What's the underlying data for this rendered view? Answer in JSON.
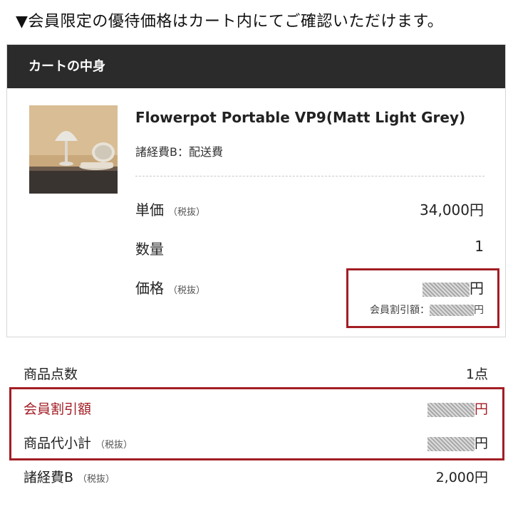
{
  "notice": "▼会員限定の優待価格はカート内にてご確認いただけます。",
  "cart": {
    "header": "カートの中身",
    "product": {
      "name": "Flowerpot Portable VP9(Matt Light Grey)",
      "sub": "諸経費B：配送費",
      "unit_price_label": "単価",
      "unit_price_tax": "（税抜）",
      "unit_price_value": "34,000円",
      "quantity_label": "数量",
      "quantity_value": "1",
      "price_label": "価格",
      "price_tax": "（税抜）",
      "price_suffix": "円",
      "member_discount_label": "会員割引額：",
      "member_discount_suffix": "円"
    }
  },
  "summary": {
    "item_count_label": "商品点数",
    "item_count_value": "1点",
    "member_discount_label": "会員割引額",
    "member_discount_suffix": "円",
    "subtotal_label": "商品代小計",
    "subtotal_tax": "（税抜）",
    "subtotal_suffix": "円",
    "expense_label": "諸経費B",
    "expense_tax": "（税抜）",
    "expense_value": "2,000円"
  },
  "colors": {
    "header_bg": "#2b2b2b",
    "highlight": "#a31d24",
    "accent_red": "#a31d24"
  },
  "icons": {
    "notice_marker": "triangle-down-glyph"
  }
}
